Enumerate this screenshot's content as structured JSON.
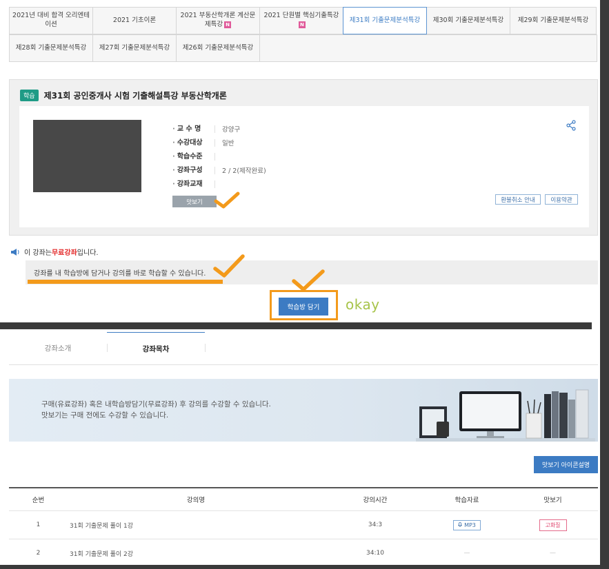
{
  "tabs": {
    "row1": [
      {
        "label": "2021년 대비 합격 오리엔테이션",
        "new": false,
        "active": false
      },
      {
        "label": "2021 기초이론",
        "new": false,
        "active": false
      },
      {
        "label": "2021 부동산학개론 계산문제특강",
        "new": true,
        "active": false
      },
      {
        "label": "2021 단원별 핵심기출특강",
        "new": true,
        "active": false
      },
      {
        "label": "제31회 기출문제분석특강",
        "new": false,
        "active": true
      },
      {
        "label": "제30회 기출문제분석특강",
        "new": false,
        "active": false
      },
      {
        "label": "제29회 기출문제분석특강",
        "new": false,
        "active": false
      }
    ],
    "row2": [
      {
        "label": "제28회 기출문제분석특강"
      },
      {
        "label": "제27회 기출문제분석특강"
      },
      {
        "label": "제26회 기출문제분석특강"
      }
    ],
    "new_badge": "N"
  },
  "course": {
    "badge": "학습",
    "title": "제31회 공인중개사 시험 기출해설특강 부동산학개론",
    "info": [
      {
        "label": "교 수 명",
        "value": "강양구"
      },
      {
        "label": "수강대상",
        "value": "일반"
      },
      {
        "label": "학습수준",
        "value": ""
      },
      {
        "label": "강좌구성",
        "value": "2 / 2(제작완료)"
      },
      {
        "label": "강좌교재",
        "value": ""
      }
    ],
    "preview_button": "맛보기",
    "refund_button": "환불취소 안내",
    "terms_button": "이용약관"
  },
  "notice": {
    "prefix": "이 강좌는 ",
    "free_label": "무료강좌",
    "suffix": " 입니다.",
    "bar_text": "강좌를 내 학습방에 담거나 강의를 바로 학습할 수 있습니다."
  },
  "cart_button": "학습방 담기",
  "annotation_text": "okay",
  "content_tabs": [
    {
      "label": "강좌소개",
      "active": false
    },
    {
      "label": "강좌목차",
      "active": true
    }
  ],
  "banner": {
    "line1": "구매(유료강좌) 혹은 내학습방담기(무료강좌) 후 강의를 수강할 수 있습니다.",
    "line2": "맛보기는 구매 전에도 수강할 수 있습니다."
  },
  "icon_guide_button": "맛보기 아이콘설명",
  "lecture_table": {
    "headers": [
      "순번",
      "강의명",
      "강의시간",
      "학습자료",
      "맛보기"
    ],
    "rows": [
      {
        "no": "1",
        "name": "31회 기출문제 풀이 1강",
        "time": "34:3",
        "material": "MP3",
        "preview": "고화질"
      },
      {
        "no": "2",
        "name": "31회 기출문제 풀이 2강",
        "time": "34:10",
        "material": "—",
        "preview": "—"
      }
    ]
  },
  "colors": {
    "accent_blue": "#3c7bc3",
    "badge_green": "#1f9b86",
    "annotation_orange": "#f39a1b",
    "free_red": "#e32929",
    "okay_green": "#a7c44a"
  }
}
